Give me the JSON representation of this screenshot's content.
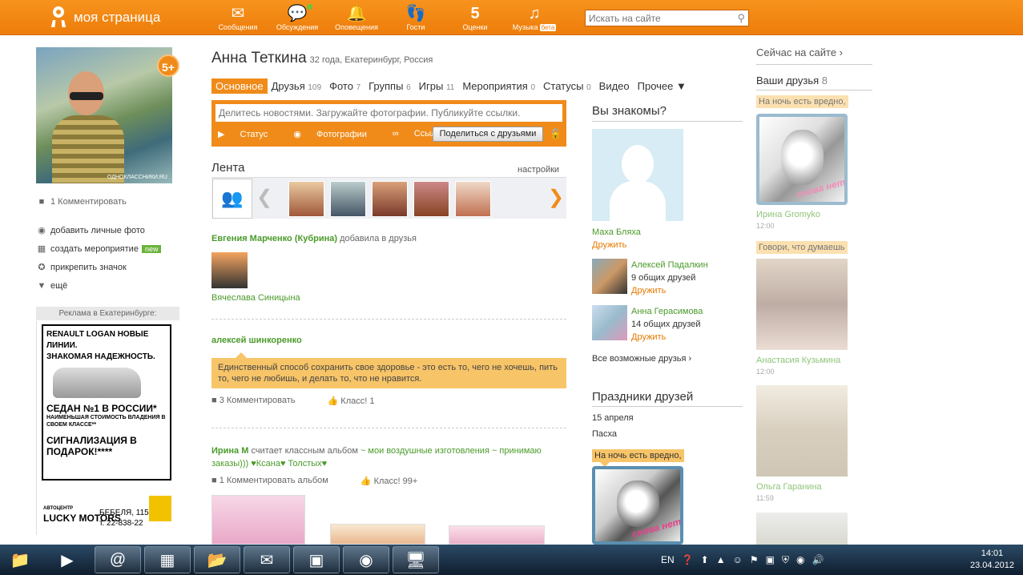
{
  "header": {
    "logo_text": "моя страница",
    "nav": [
      {
        "label": "Сообщения",
        "icon": "envelope-icon",
        "glyph": "✉"
      },
      {
        "label": "Обсуждения",
        "icon": "chat-bubbles-icon",
        "glyph": "💬"
      },
      {
        "label": "Оповещения",
        "icon": "bell-icon",
        "glyph": "🔔"
      },
      {
        "label": "Гости",
        "icon": "footprints-icon",
        "glyph": "👣"
      },
      {
        "label": "Оценки",
        "icon": "rating-five-icon",
        "glyph": "5"
      },
      {
        "label": "Музыка",
        "icon": "music-note-icon",
        "glyph": "♫",
        "badge": "бета"
      }
    ],
    "search_placeholder": "Искать на сайте"
  },
  "profile": {
    "name": "Анна Теткина",
    "details": "32 года, Екатеринбург, Россия",
    "photo_watermark": "ОДНОКЛАССНИКИ.RU",
    "rating_badge": "5+",
    "comment_link": "1 Комментировать",
    "links": [
      {
        "label": "добавить личные фото",
        "icon": "camera-icon"
      },
      {
        "label": "создать мероприятие",
        "icon": "calendar-icon",
        "badge": "new"
      },
      {
        "label": "прикрепить значок",
        "icon": "star-badge-icon"
      },
      {
        "label": "ещё",
        "icon": "triangle-down-icon"
      }
    ]
  },
  "ad": {
    "header": "Реклама в Екатеринбурге:",
    "line1": "RENAULT LOGAN НОВЫЕ ЛИНИИ.",
    "line2": "ЗНАКОМАЯ НАДЕЖНОСТЬ.",
    "line3": "СЕДАН №1 В РОССИИ*",
    "line4": "НАИМЕНЬШАЯ СТОИМОСТЬ ВЛАДЕНИЯ В СВОЕМ КЛАССЕ**",
    "line5": "СИГНАЛИЗАЦИЯ В ПОДАРОК!****",
    "dealer_top": "АВТОЦЕНТР",
    "dealer": "LUCKY MOTORS",
    "address": "БЕБЕЛЯ, 115",
    "phone": "т. 22-838-22"
  },
  "tabs": [
    {
      "label": "Основное",
      "count": "",
      "active": true
    },
    {
      "label": "Друзья",
      "count": "109"
    },
    {
      "label": "Фото",
      "count": "7"
    },
    {
      "label": "Группы",
      "count": "6"
    },
    {
      "label": "Игры",
      "count": "11"
    },
    {
      "label": "Мероприятия",
      "count": "0"
    },
    {
      "label": "Статусы",
      "count": "0"
    },
    {
      "label": "Видео",
      "count": ""
    },
    {
      "label": "Прочее ▼",
      "count": ""
    }
  ],
  "share": {
    "placeholder": "Делитесь новостями. Загружайте фотографии. Публикуйте ссылки.",
    "status": "Статус",
    "photos": "Фотографии",
    "link": "Ссылка",
    "button": "Поделиться с друзьями"
  },
  "feed": {
    "title": "Лента",
    "settings": "настройки",
    "item1_user": "Евгения Марченко (Кубрина)",
    "item1_action": "добавила в друзья",
    "item1_friend": "Вячеслава Синицына",
    "item2_user": "алексей шинкоренко",
    "item2_quote": "Единственный способ сохранить свое здоровье - это есть то, чего не хочешь, пить то, чего не любишь, и делать то, что не нравится.",
    "item2_comments": "3 Комментировать",
    "item2_class": "Класс! 1",
    "item3_user": "Ирина М",
    "item3_action": "считает классным альбом",
    "item3_album": "~ мои воздушные изготовления ~ принимаю заказы))) ♥Ксана♥ Толстых♥",
    "item3_comments": "1 Комментировать альбом",
    "item3_class": "Класс! 99+"
  },
  "know": {
    "title": "Вы знакомы?",
    "p1_name": "Маха Бляха",
    "p1_action": "Дружить",
    "p2_name": "Алексей Падалкин",
    "p2_mutual": "9 общих друзей",
    "p2_action": "Дружить",
    "p3_name": "Анна Герасимова",
    "p3_mutual": "14 общих друзей",
    "p3_action": "Дружить",
    "all": "Все возможные друзья ›"
  },
  "holidays": {
    "title": "Праздники друзей",
    "date": "15 апреля",
    "holiday": "Пасха",
    "bubble": "На ночь есть вредно,",
    "sketch_text": "снова нет"
  },
  "right": {
    "online": "Сейчас на сайте ›",
    "friends_label": "Ваши друзья",
    "friends_count": "8",
    "f1_bubble": "На ночь есть вредно,",
    "f1_name": "Ирина Gromyko",
    "f1_time": "12:00",
    "f2_bubble": "Говори, что думаешь",
    "f2_name": "Анастасия Кузьмина",
    "f2_time": "12:00",
    "f3_name": "Ольга Гаранина",
    "f3_time": "11:59"
  },
  "taskbar": {
    "lang": "EN",
    "time": "14:01",
    "date": "23.04.2012"
  },
  "colors": {
    "brand_orange": "#f08b1a",
    "link_green": "#4a9a2a",
    "quote_bg": "#f7c468"
  }
}
